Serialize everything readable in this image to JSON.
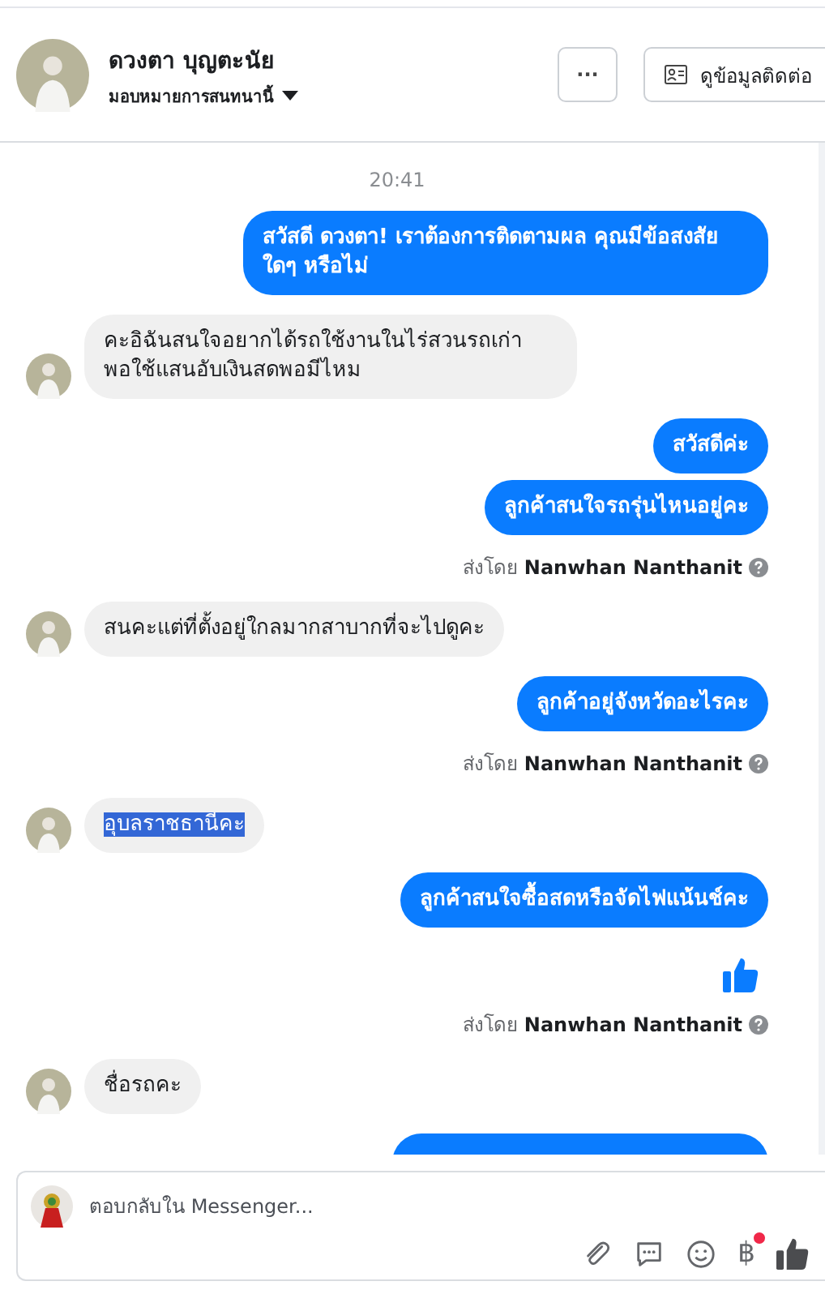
{
  "header": {
    "name": "ดวงตา บุญตะนัย",
    "assign_label": "มอบหมายการสนทนานี้",
    "more_button": "···",
    "contact_button": "ดูข้อมูลติดต่อ"
  },
  "messages": [
    {
      "kind": "time",
      "text": "20:41"
    },
    {
      "kind": "out",
      "text": "สวัสดี ดวงตา! เราต้องการติดตามผล คุณมีข้อสงสัยใดๆ หรือไม่"
    },
    {
      "kind": "in",
      "text": "คะอิฉันสนใจอยากได้รถใช้งานในไร่สวนรถเก่าพอใช้แสนอับเงินสดพอมีไหม",
      "highlighted": false
    },
    {
      "kind": "out",
      "text": "สวัสดีค่ะ"
    },
    {
      "kind": "out",
      "text": "ลูกค้าสนใจรถรุ่นไหนอยู่คะ"
    },
    {
      "kind": "sent_by",
      "prefix": "ส่งโดย",
      "name": "Nanwhan Nanthanit"
    },
    {
      "kind": "in",
      "text": "สนคะแต่ที่ตั้งอยู่ใกลมากสาบากที่จะไปดูคะ",
      "highlighted": false
    },
    {
      "kind": "out",
      "text": "ลูกค้าอยู่จังหวัดอะไรคะ"
    },
    {
      "kind": "sent_by",
      "prefix": "ส่งโดย",
      "name": "Nanwhan Nanthanit"
    },
    {
      "kind": "in",
      "text": "อุบลราชธานีคะ",
      "highlighted": true
    },
    {
      "kind": "out",
      "text": "ลูกค้าสนใจซื้อสดหรือจัดไฟแน้นช์คะ"
    },
    {
      "kind": "like"
    },
    {
      "kind": "sent_by",
      "prefix": "ส่งโดย",
      "name": "Nanwhan Nanthanit"
    },
    {
      "kind": "in",
      "text": "ชื่อรถคะ",
      "highlighted": false
    },
    {
      "kind": "clipped"
    }
  ],
  "composer": {
    "placeholder": "ตอบกลับใน Messenger...",
    "currency_symbol": "฿",
    "currency_notification": true
  }
}
